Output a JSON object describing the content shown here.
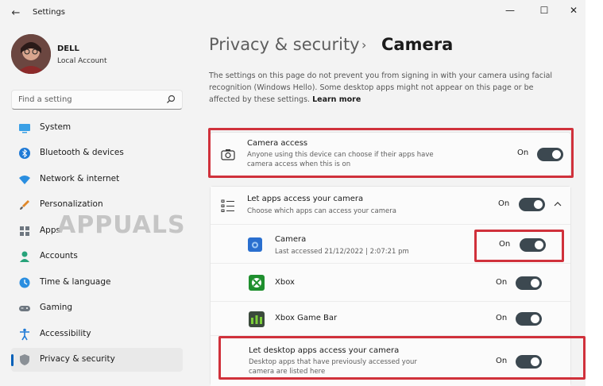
{
  "window": {
    "app_title": "Settings",
    "controls": {
      "minimize": "—",
      "maximize": "☐",
      "close": "✕"
    }
  },
  "user": {
    "name": "DELL",
    "account": "Local Account"
  },
  "search": {
    "placeholder": "Find a setting"
  },
  "nav": [
    {
      "label": "System",
      "icon": "display-icon"
    },
    {
      "label": "Bluetooth & devices",
      "icon": "bluetooth-icon"
    },
    {
      "label": "Network & internet",
      "icon": "wifi-icon"
    },
    {
      "label": "Personalization",
      "icon": "brush-icon"
    },
    {
      "label": "Apps",
      "icon": "apps-icon"
    },
    {
      "label": "Accounts",
      "icon": "person-icon"
    },
    {
      "label": "Time & language",
      "icon": "clock-globe-icon"
    },
    {
      "label": "Gaming",
      "icon": "gamepad-icon"
    },
    {
      "label": "Accessibility",
      "icon": "accessibility-icon"
    },
    {
      "label": "Privacy & security",
      "icon": "shield-icon",
      "active": true
    }
  ],
  "breadcrumb": {
    "parent": "Privacy & security",
    "separator": "›",
    "current": "Camera"
  },
  "description": {
    "text": "The settings on this page do not prevent you from signing in with your camera using facial recognition (Windows Hello). Some desktop apps might not appear on this page or be affected by these settings.",
    "link": "Learn more"
  },
  "camera_access": {
    "title": "Camera access",
    "desc_line1": "Anyone using this device can choose if their apps have",
    "desc_line2": "camera access when this is on",
    "state": "On"
  },
  "let_apps": {
    "title": "Let apps access your camera",
    "desc": "Choose which apps can access your camera",
    "state": "On"
  },
  "apps": [
    {
      "name": "Camera",
      "sub": "Last accessed 21/12/2022  |  2:07:21 pm",
      "state": "On"
    },
    {
      "name": "Xbox",
      "state": "On"
    },
    {
      "name": "Xbox Game Bar",
      "state": "On"
    }
  ],
  "desktop_apps": {
    "title": "Let desktop apps access your camera",
    "desc_line1": "Desktop apps that have previously accessed your",
    "desc_line2": "camera are listed here",
    "state": "On"
  },
  "watermark": "APPUALS",
  "colors": {
    "accent": "#005fb8",
    "toggle_on": "#3c4850",
    "highlight": "#d0313b"
  }
}
